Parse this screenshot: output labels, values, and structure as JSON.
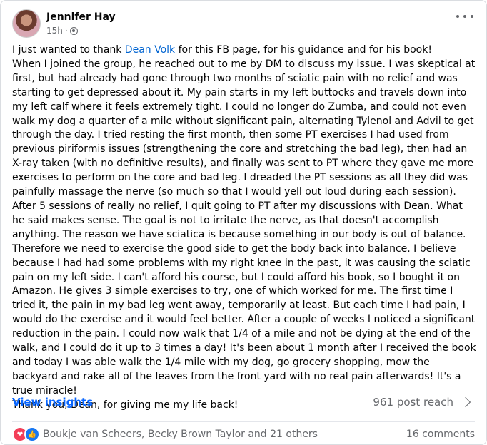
{
  "post": {
    "author": "Jennifer Hay",
    "time": "15h",
    "separator": "·",
    "privacy_icon": "globe-icon",
    "more_icon": "more-options-icon",
    "body_pre_link": "I just wanted to thank ",
    "mention": "Dean Volk",
    "body_post_link": " for this FB page, for his guidance and for his book!\nWhen I joined the group, he reached out to me by DM to discuss my issue. I was skeptical at first, but had already had gone through two months of sciatic pain with no relief and was starting to get depressed about it. My pain starts in my left buttocks and travels down into my left calf where it feels extremely tight. I could no longer do Zumba, and could not even walk my dog a quarter of a mile without significant pain, alternating Tylenol and Advil to get through the day. I tried resting the first month, then some PT exercises I had used from previous piriformis issues (strengthening the core and stretching the bad leg), then had an X-ray taken (with no definitive results), and finally was sent to PT where they gave me more exercises to perform on the core and bad leg. I dreaded the PT sessions as all they did was painfully massage the nerve (so much so that I would yell out loud during each session). After 5 sessions of really no relief, I quit going to PT after my discussions with Dean. What he said makes sense. The goal is not to irritate the nerve, as that doesn't accomplish anything. The reason we have sciatica is because something in our body is out of balance. Therefore we need to exercise the good side to get the body back into balance. I believe because I had had some problems with my right knee in the past, it was causing the sciatic pain on my left side. I can't afford his course, but I could afford his book, so I bought it on Amazon. He gives 3 simple exercises to try, one of which worked for me. The first time I tried it, the pain in my bad leg went away, temporarily at least. But each time I had pain, I would do the exercise and it would feel better. After a couple of weeks I noticed a significant reduction in the pain. I could now walk that 1/4 of a mile and not be dying at the end of the walk, and I could do it up to 3 times a day! It's been about 1 month after I received the book and today I was able walk the 1/4 mile with my dog, go grocery shopping, mow the backyard and rake all of the leaves from the front yard with no real pain afterwards! It's a true miracle!\nThank you, Dean, for giving me my life back!"
  },
  "insights": {
    "label": "View insights",
    "reach": "961 post reach",
    "chevron_icon": "chevron-right-icon"
  },
  "footer": {
    "reaction_icons": [
      "love-reaction-icon",
      "like-reaction-icon"
    ],
    "reactors": "Boukje van Scheers, Becky Brown Taylor and 21 others",
    "comments": "16 comments"
  },
  "colors": {
    "link": "#0064d1",
    "insights": "#0866ff",
    "secondary_text": "#65676b",
    "love": "#f33e58",
    "like": "#1877f2"
  }
}
